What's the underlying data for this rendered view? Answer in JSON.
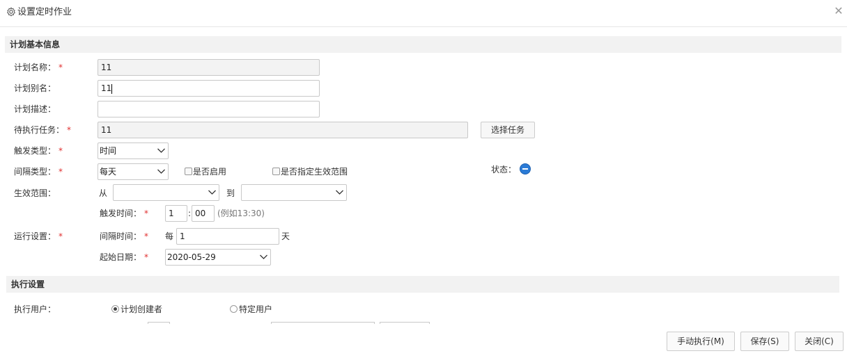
{
  "dialog": {
    "title": "设置定时作业",
    "close_icon": "close-icon",
    "settings_icon": "gear-icon"
  },
  "basic_section": {
    "title": "计划基本信息"
  },
  "fields": {
    "plan_name": {
      "label": "计划名称：",
      "value": "11"
    },
    "plan_alias": {
      "label": "计划别名：",
      "value": "11"
    },
    "plan_desc": {
      "label": "计划描述：",
      "value": ""
    },
    "pending_task": {
      "label": "待执行任务：",
      "value": "11",
      "button": "选择任务"
    },
    "trigger_type": {
      "label": "触发类型：",
      "value": "时间"
    },
    "interval_type": {
      "label": "间隔类型：",
      "value": "每天"
    },
    "enable_check": {
      "label": "是否启用",
      "checked": false
    },
    "range_check": {
      "label": "是否指定生效范围",
      "checked": false
    },
    "status": {
      "label": "状态："
    },
    "effective_range": {
      "label": "生效范围：",
      "from": "从",
      "to": "到",
      "from_value": "",
      "to_value": ""
    },
    "run_settings": {
      "label": "运行设置："
    },
    "trigger_time": {
      "label": "触发时间：",
      "hour": "1",
      "sep": ":",
      "minute": "00",
      "hint": "(例如13:30)"
    },
    "interval_time": {
      "label": "间隔时间：",
      "prefix": "每",
      "value": "1",
      "suffix": "天"
    },
    "start_date": {
      "label": "起始日期：",
      "value": "2020-05-29"
    }
  },
  "exec_section": {
    "title": "执行设置"
  },
  "exec_user": {
    "label": "执行用户：",
    "option_creator": "计划创建者",
    "option_specific": "特定用户",
    "selected": "creator"
  },
  "footer": {
    "run_manual": "手动执行(M)",
    "save": "保存(S)",
    "close": "关闭(C)"
  }
}
